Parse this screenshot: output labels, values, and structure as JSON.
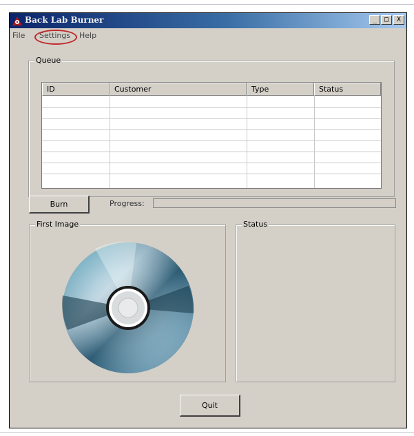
{
  "window": {
    "title": "Back Lab Burner",
    "controls": {
      "minimize": "_",
      "maximize": "□",
      "close": "X"
    }
  },
  "menu": {
    "items": [
      "File",
      "Settings",
      "Help"
    ]
  },
  "queue": {
    "label": "Queue",
    "columns": [
      "ID",
      "Customer",
      "Type",
      "Status"
    ],
    "rows": [
      [],
      [],
      [],
      [],
      [],
      [],
      [],
      []
    ]
  },
  "actions": {
    "burn_label": "Burn",
    "quit_label": "Quit"
  },
  "progress": {
    "label": "Progress:",
    "value": 0
  },
  "first_image": {
    "label": "First Image",
    "icon": "cd-disc-icon"
  },
  "status_panel": {
    "label": "Status"
  },
  "colors": {
    "titlebar_start": "#0a246a",
    "titlebar_end": "#a6caf0",
    "highlight_circle": "#c0282a",
    "window_bg": "#d4d0c8"
  }
}
